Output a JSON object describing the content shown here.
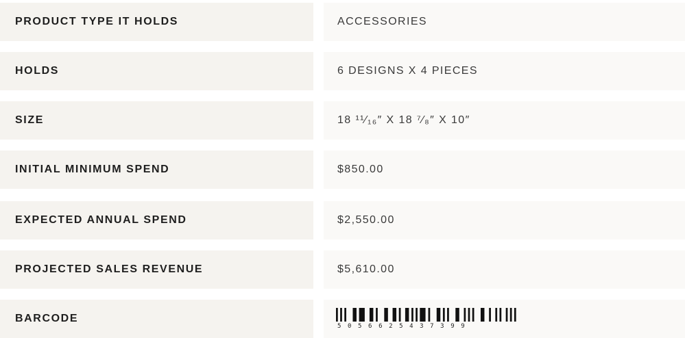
{
  "specs": [
    {
      "label": "PRODUCT TYPE IT HOLDS",
      "value": "ACCESSORIES"
    },
    {
      "label": "HOLDS",
      "value": "6 DESIGNS X 4 PIECES"
    },
    {
      "label": "SIZE",
      "value": "18 ¹¹⁄₁₆″ X 18 ⁷⁄₈″ X 10″"
    },
    {
      "label": "INITIAL MINIMUM SPEND",
      "value": "$850.00"
    },
    {
      "label": "EXPECTED ANNUAL SPEND",
      "value": "$2,550.00"
    },
    {
      "label": "PROJECTED SALES REVENUE",
      "value": "$5,610.00"
    }
  ],
  "barcode": {
    "label": "BARCODE",
    "digits": "5056625437399"
  },
  "colors": {
    "label_bg": "#f5f3ef",
    "value_bg": "#faf9f7",
    "text": "#1e1e1e"
  }
}
